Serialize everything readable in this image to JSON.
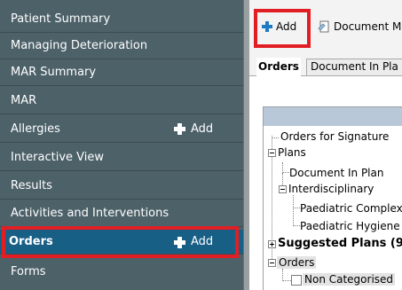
{
  "sidebar": {
    "items": [
      {
        "label": "Patient Summary"
      },
      {
        "label": "Managing Deterioration"
      },
      {
        "label": "MAR Summary"
      },
      {
        "label": "MAR"
      },
      {
        "label": "Allergies",
        "add_label": "Add"
      },
      {
        "label": "Interactive View"
      },
      {
        "label": "Results"
      },
      {
        "label": "Activities and Interventions"
      },
      {
        "label": "Orders",
        "add_label": "Add",
        "selected": true
      },
      {
        "label": "Forms"
      }
    ],
    "highlight_color": "#e01e24",
    "selected_color": "#185f86"
  },
  "toolbar": {
    "add_label": "Add",
    "document_label": "Document M"
  },
  "tabs": [
    {
      "label": "Orders",
      "active": true
    },
    {
      "label": "Document In Pla"
    }
  ],
  "tree": {
    "orders_for_signature": "Orders for Signature",
    "plans": "Plans",
    "document_in_plan": "Document In Plan",
    "interdisciplinary": "Interdisciplinary",
    "paediatric_complex": "Paediatric Complex",
    "paediatric_hygiene": "Paediatric Hygiene",
    "suggested_plans": "Suggested Plans (9",
    "orders": "Orders",
    "non_categorised": "Non Categorised"
  }
}
